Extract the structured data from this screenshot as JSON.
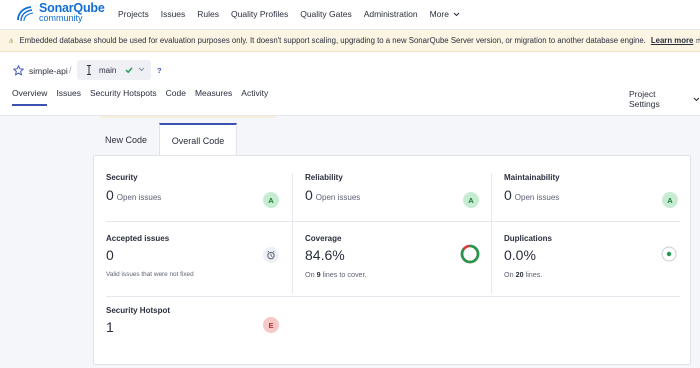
{
  "nav": {
    "logo_name": "SonarQube",
    "logo_sub": "community",
    "links": [
      "Projects",
      "Issues",
      "Rules",
      "Quality Profiles",
      "Quality Gates",
      "Administration"
    ],
    "more_label": "More"
  },
  "banner": {
    "text": "Embedded database should be used for evaluation purposes only. It doesn't support scaling, upgrading to a new SonarQube Server version, or migration to another database engine.",
    "link_label": "Learn more"
  },
  "project": {
    "name": "simple-api",
    "slash": "/",
    "branch": "main",
    "help": "?",
    "tabs": [
      "Overview",
      "Issues",
      "Security Hotspots",
      "Code",
      "Measures",
      "Activity"
    ],
    "active_tab": 0,
    "settings_label": "Project Settings"
  },
  "code_tabs": {
    "new_code": "New Code",
    "overall_code": "Overall Code"
  },
  "measures": {
    "security": {
      "title": "Security",
      "value": "0",
      "unit": "Open issues",
      "grade": "A"
    },
    "reliability": {
      "title": "Reliability",
      "value": "0",
      "unit": "Open issues",
      "grade": "A"
    },
    "maintainability": {
      "title": "Maintainability",
      "value": "0",
      "unit": "Open issues",
      "grade": "A"
    },
    "accepted": {
      "title": "Accepted issues",
      "value": "0",
      "sub": "Valid issues that were not fixed"
    },
    "coverage": {
      "title": "Coverage",
      "value": "84.6%",
      "sub_pre": "On",
      "sub_num": "9",
      "sub_post": "lines to cover.",
      "percent": 84.6
    },
    "duplications": {
      "title": "Duplications",
      "value": "0.0%",
      "sub_pre": "On",
      "sub_num": "20",
      "sub_post": "lines."
    },
    "hotspot": {
      "title": "Security Hotspot",
      "value": "1",
      "grade": "E"
    }
  },
  "colors": {
    "accent": "#3b52b4",
    "grade_a_bg": "#c7ecd1",
    "grade_e_bg": "#f6c8c8",
    "coverage_good": "#1f9a4b",
    "coverage_bad": "#d63a3a"
  }
}
